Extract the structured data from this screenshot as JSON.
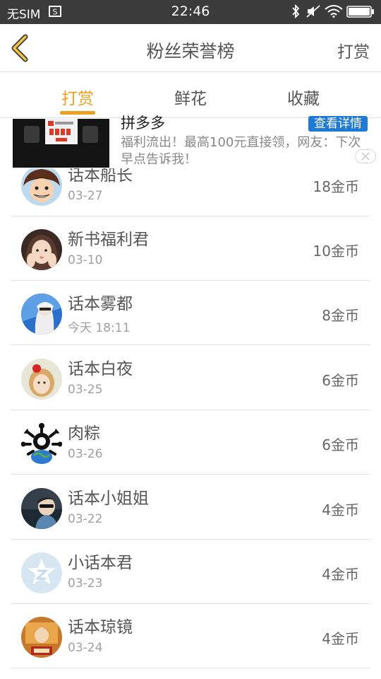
{
  "status_bar": {
    "carrier": "无SIM",
    "time": "22:46",
    "icons": [
      "notification-icon",
      "bluetooth-icon",
      "mute-icon",
      "wifi-icon",
      "battery-icon"
    ]
  },
  "header": {
    "title": "粉丝荣誉榜",
    "right_label": "打赏",
    "back_icon": "chevron-left-icon",
    "accent_color": "#f0a020"
  },
  "tabs": [
    {
      "label": "打赏",
      "active": true
    },
    {
      "label": "鲜花",
      "active": false
    },
    {
      "label": "收藏",
      "active": false
    }
  ],
  "ad": {
    "title": "拼多多",
    "button_label": "查看详情",
    "description": "福利流出！最高100元直接领，网友：下次早点告诉我！"
  },
  "fans": [
    {
      "name": "话本船长",
      "date": "03-27",
      "coins": "18金币"
    },
    {
      "name": "新书福利君",
      "date": "03-10",
      "coins": "10金币"
    },
    {
      "name": "话本雾都",
      "date": "今天 18:11",
      "coins": "8金币"
    },
    {
      "name": "话本白夜",
      "date": "03-25",
      "coins": "6金币"
    },
    {
      "name": "肉粽",
      "date": "03-26",
      "coins": "6金币"
    },
    {
      "name": "话本小姐姐",
      "date": "03-22",
      "coins": "4金币"
    },
    {
      "name": "小话本君",
      "date": "03-23",
      "coins": "4金币"
    },
    {
      "name": "话本琼镜",
      "date": "03-24",
      "coins": "4金币"
    }
  ]
}
